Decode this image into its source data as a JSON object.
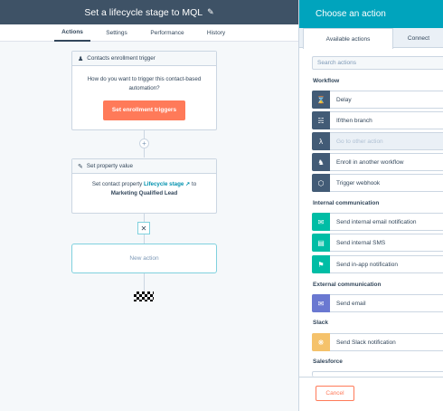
{
  "header": {
    "title": "Set a lifecycle stage to MQL"
  },
  "tabs": [
    "Actions",
    "Settings",
    "Performance",
    "History"
  ],
  "trigger_card": {
    "title": "Contacts enrollment trigger",
    "prompt": "How do you want to trigger this contact-based automation?",
    "button": "Set enrollment triggers"
  },
  "property_card": {
    "title": "Set property value",
    "line_prefix": "Set contact property",
    "property": "Lifecycle stage",
    "to_word": "to",
    "value": "Marketing Qualified Lead"
  },
  "new_action_label": "New action",
  "panel": {
    "title": "Choose an action",
    "tabs": [
      "Available actions",
      "Connect"
    ],
    "search_placeholder": "Search actions",
    "sections": [
      {
        "title": "Workflow",
        "items": [
          {
            "label": "Delay",
            "icon": "hourglass-icon",
            "color": "#425b76"
          },
          {
            "label": "If/then branch",
            "icon": "branch-icon",
            "color": "#425b76"
          },
          {
            "label": "Go to other action",
            "icon": "goto-icon",
            "color": "#425b76",
            "disabled": true
          },
          {
            "label": "Enroll in another workflow",
            "icon": "workflow-icon",
            "color": "#425b76"
          },
          {
            "label": "Trigger webhook",
            "icon": "webhook-icon",
            "color": "#425b76"
          }
        ]
      },
      {
        "title": "Internal communication",
        "items": [
          {
            "label": "Send internal email notification",
            "icon": "email-icon",
            "color": "#00bda5"
          },
          {
            "label": "Send internal SMS",
            "icon": "sms-icon",
            "color": "#00bda5"
          },
          {
            "label": "Send in-app notification",
            "icon": "bell-icon",
            "color": "#00bda5"
          }
        ]
      },
      {
        "title": "External communication",
        "items": [
          {
            "label": "Send email",
            "icon": "email-icon",
            "color": "#6a78d1"
          }
        ]
      },
      {
        "title": "Slack",
        "items": [
          {
            "label": "Send Slack notification",
            "icon": "slack-icon",
            "color": "#f5c26b"
          }
        ]
      },
      {
        "title": "Salesforce",
        "items": []
      }
    ],
    "cancel_label": "Cancel"
  }
}
